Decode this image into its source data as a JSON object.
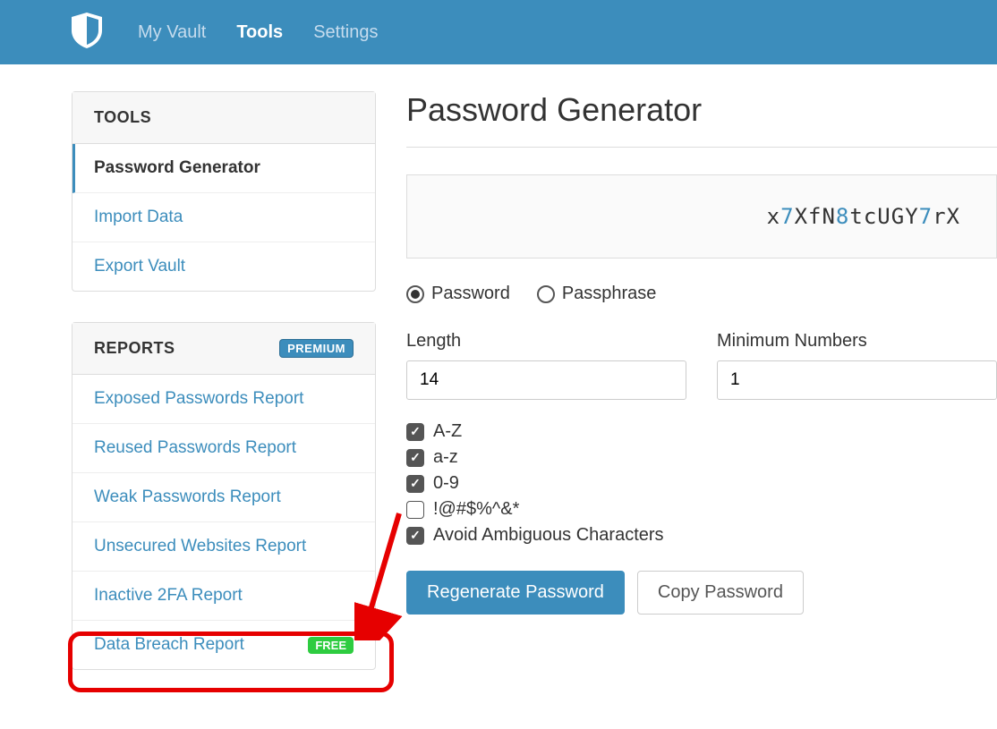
{
  "nav": {
    "my_vault": "My Vault",
    "tools": "Tools",
    "settings": "Settings"
  },
  "sidebar": {
    "tools_header": "TOOLS",
    "tools_items": [
      {
        "label": "Password Generator",
        "active": true
      },
      {
        "label": "Import Data",
        "active": false
      },
      {
        "label": "Export Vault",
        "active": false
      }
    ],
    "reports_header": "REPORTS",
    "premium_badge": "PREMIUM",
    "reports_items": [
      {
        "label": "Exposed Passwords Report"
      },
      {
        "label": "Reused Passwords Report"
      },
      {
        "label": "Weak Passwords Report"
      },
      {
        "label": "Unsecured Websites Report"
      },
      {
        "label": "Inactive 2FA Report"
      },
      {
        "label": "Data Breach Report",
        "badge": "FREE"
      }
    ]
  },
  "main": {
    "title": "Password Generator",
    "password_chars": [
      {
        "c": "x",
        "t": "a"
      },
      {
        "c": "7",
        "t": "n"
      },
      {
        "c": "X",
        "t": "a"
      },
      {
        "c": "f",
        "t": "a"
      },
      {
        "c": "N",
        "t": "a"
      },
      {
        "c": "8",
        "t": "n"
      },
      {
        "c": "t",
        "t": "a"
      },
      {
        "c": "c",
        "t": "a"
      },
      {
        "c": "U",
        "t": "a"
      },
      {
        "c": "G",
        "t": "a"
      },
      {
        "c": "Y",
        "t": "a"
      },
      {
        "c": "7",
        "t": "n"
      },
      {
        "c": "r",
        "t": "a"
      },
      {
        "c": "X",
        "t": "a"
      }
    ],
    "type_options": {
      "password": "Password",
      "passphrase": "Passphrase",
      "selected": "password"
    },
    "length_label": "Length",
    "length_value": "14",
    "min_numbers_label": "Minimum Numbers",
    "min_numbers_value": "1",
    "checks": [
      {
        "label": "A-Z",
        "checked": true
      },
      {
        "label": "a-z",
        "checked": true
      },
      {
        "label": "0-9",
        "checked": true
      },
      {
        "label": "!@#$%^&*",
        "checked": false
      },
      {
        "label": "Avoid Ambiguous Characters",
        "checked": true
      }
    ],
    "regenerate_btn": "Regenerate Password",
    "copy_btn": "Copy Password"
  },
  "annotation": {
    "highlights": "Data Breach Report"
  }
}
